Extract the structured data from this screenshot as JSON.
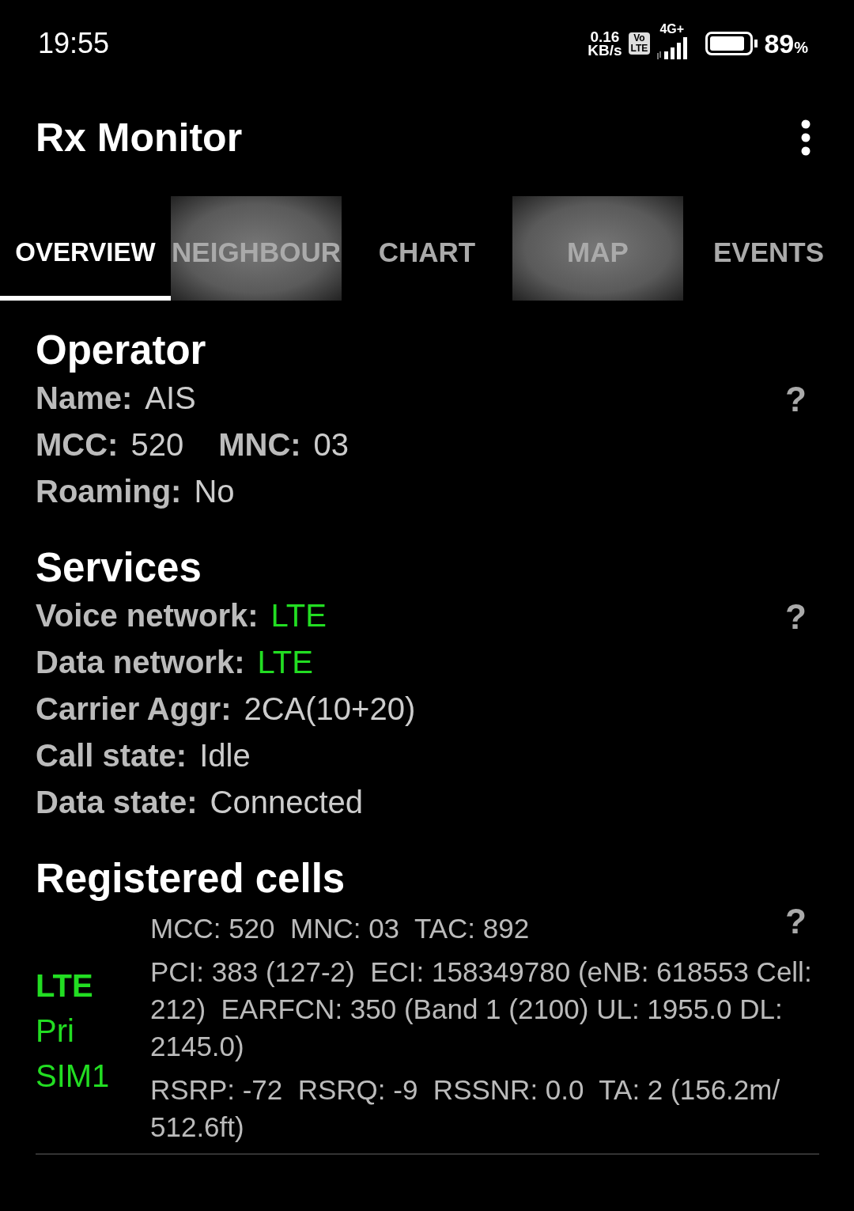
{
  "status_bar": {
    "time": "19:55",
    "speed_value": "0.16",
    "speed_unit": "KB/s",
    "volte_top": "Vo",
    "volte_bottom": "LTE",
    "network": "4G+",
    "battery_text": "89",
    "battery_unit": "%"
  },
  "app_bar": {
    "title": "Rx Monitor"
  },
  "tabs": [
    {
      "label": "OVERVIEW",
      "selected": true,
      "pressed": false
    },
    {
      "label": "NEIGHBOUR",
      "selected": false,
      "pressed": true
    },
    {
      "label": "CHART",
      "selected": false,
      "pressed": false
    },
    {
      "label": "MAP",
      "selected": false,
      "pressed": true
    },
    {
      "label": "EVENTS",
      "selected": false,
      "pressed": false
    }
  ],
  "sections": [
    {
      "kind": "fields",
      "title": "Operator",
      "help": "?",
      "rows": [
        [
          {
            "label": "Name:",
            "value": "AIS",
            "color": "#cccccc"
          }
        ],
        [
          {
            "label": "MCC:",
            "value": "520",
            "color": "#cccccc"
          },
          {
            "label": "MNC:",
            "value": "03",
            "color": "#cccccc"
          }
        ],
        [
          {
            "label": "Roaming:",
            "value": "No",
            "color": "#cccccc"
          }
        ]
      ]
    },
    {
      "kind": "fields",
      "title": "Services",
      "help": "?",
      "rows": [
        [
          {
            "label": "Voice network:",
            "value": "LTE",
            "color": "#22dd22"
          }
        ],
        [
          {
            "label": "Data network:",
            "value": "LTE",
            "color": "#22dd22"
          }
        ],
        [
          {
            "label": "Carrier Aggr:",
            "value": "2CA(10+20)",
            "color": "#cccccc"
          }
        ],
        [
          {
            "label": "Call state:",
            "value": "Idle",
            "color": "#cccccc"
          }
        ],
        [
          {
            "label": "Data state:",
            "value": "Connected",
            "color": "#cccccc"
          }
        ]
      ]
    },
    {
      "kind": "cells",
      "title": "Registered cells",
      "help": "?",
      "cells": [
        {
          "tech": "LTE",
          "role": "Pri",
          "sim": "SIM1",
          "lines": [
            "MCC: 520  MNC: 03  TAC: 892",
            "PCI: 383 (127-2)  ECI: 158349780 (eNB: 618553 Cell: 212)  EARFCN: 350 (Band 1 (2100) UL: 1955.0 DL: 2145.0)",
            "RSRP: -72  RSRQ: -9  RSSNR: 0.0  TA: 2 (156.2m/ 512.6ft)"
          ]
        }
      ]
    }
  ]
}
